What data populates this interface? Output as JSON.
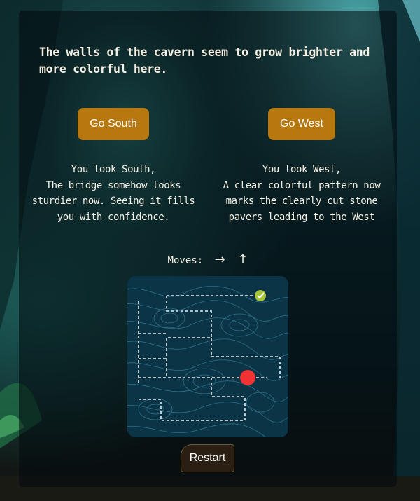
{
  "scene": {
    "text": "The walls of the cavern seem to grow brighter and more colorful here."
  },
  "choices": [
    {
      "button_label": "Go South",
      "description": "You look South,\nThe bridge somehow looks sturdier now. Seeing it fills you with confidence."
    },
    {
      "button_label": "Go West",
      "description": "You look West,\nA clear colorful pattern now marks the clearly cut stone pavers leading to the West"
    }
  ],
  "moves": {
    "label": "Moves:",
    "arrows": "→ ↑"
  },
  "map": {
    "player_marker_color": "#f03232",
    "goal_marker_color": "#a5c43a"
  },
  "restart_label": "Restart",
  "colors": {
    "button": "#b87810",
    "panel": "#020a0c",
    "text": "#f4f0e4"
  }
}
